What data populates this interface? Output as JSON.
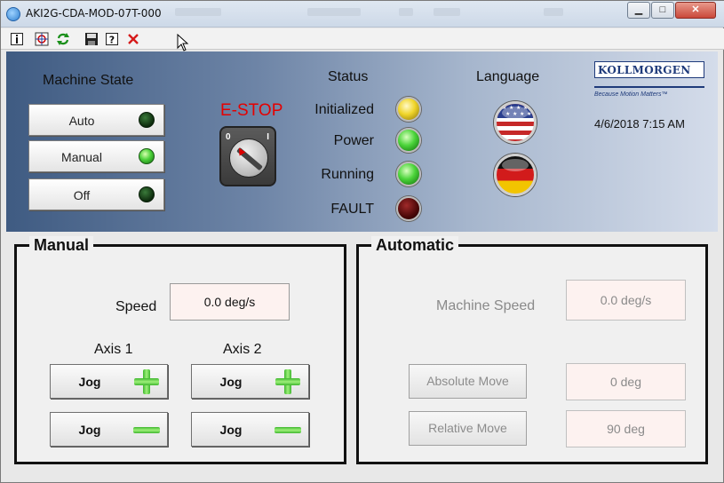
{
  "window": {
    "title": "AKI2G-CDA-MOD-07T-000",
    "minimize_glyph": "▁",
    "maximize_glyph": "□",
    "close_glyph": "✕"
  },
  "toolbar": {
    "icons": [
      "info-icon",
      "target-icon",
      "refresh-icon",
      "save-icon",
      "help-icon",
      "close-icon"
    ]
  },
  "machine_state": {
    "title": "Machine State",
    "buttons": [
      {
        "label": "Auto",
        "led": "off"
      },
      {
        "label": "Manual",
        "led": "on"
      },
      {
        "label": "Off",
        "led": "off"
      }
    ]
  },
  "estop": {
    "label": "E-STOP",
    "off_mark": "0",
    "on_mark": "I"
  },
  "status": {
    "title": "Status",
    "items": [
      {
        "label": "Initialized",
        "color": "yellow"
      },
      {
        "label": "Power",
        "color": "green"
      },
      {
        "label": "Running",
        "color": "green"
      },
      {
        "label": "FAULT",
        "color": "red"
      }
    ]
  },
  "language": {
    "title": "Language",
    "options": [
      "us-flag-icon",
      "germany-flag-icon"
    ]
  },
  "brand": {
    "logo": "KOLLMORGEN",
    "tagline": "Because Motion Matters™"
  },
  "datetime": "4/6/2018 7:15 AM",
  "manual": {
    "title": "Manual",
    "speed_label": "Speed",
    "speed_value": "0.0 deg/s",
    "axis1_label": "Axis 1",
    "axis2_label": "Axis 2",
    "jog_label": "Jog"
  },
  "automatic": {
    "title": "Automatic",
    "machine_speed_label": "Machine Speed",
    "machine_speed_value": "0.0 deg/s",
    "absolute_move_label": "Absolute Move",
    "absolute_move_value": "0 deg",
    "relative_move_label": "Relative Move",
    "relative_move_value": "90 deg"
  },
  "colors": {
    "estop_red": "#e50000",
    "led_green": "#4cd13a",
    "brand_blue": "#1e3a7a"
  }
}
